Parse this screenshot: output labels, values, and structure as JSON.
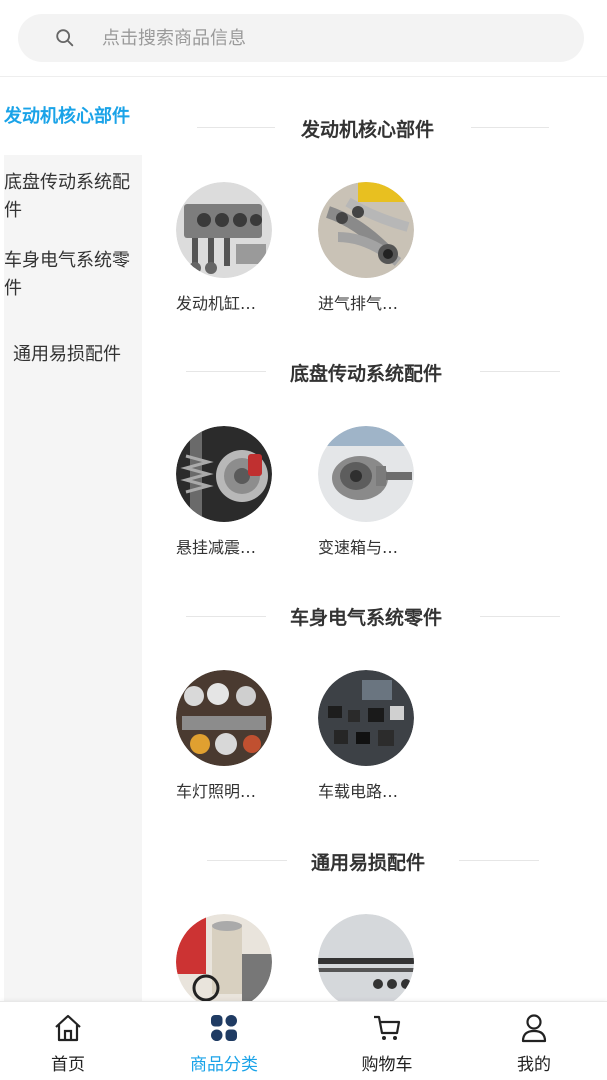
{
  "search": {
    "placeholder": "点击搜索商品信息"
  },
  "sidebar": {
    "items": [
      {
        "label": "发动机核心部件",
        "active": true
      },
      {
        "label": "底盘传动系统配件",
        "active": false
      },
      {
        "label": "车身电气系统零件",
        "active": false
      },
      {
        "label": "通用易损配件",
        "active": false
      }
    ]
  },
  "sections": [
    {
      "title": "发动机核心部件",
      "products": [
        {
          "name": "发动机缸…",
          "icon": "engine-block-photo"
        },
        {
          "name": "进气排气…",
          "icon": "exhaust-manifold-photo"
        }
      ]
    },
    {
      "title": "底盘传动系统配件",
      "products": [
        {
          "name": "悬挂减震…",
          "icon": "suspension-brake-photo"
        },
        {
          "name": "变速箱与…",
          "icon": "gearbox-photo"
        }
      ]
    },
    {
      "title": "车身电气系统零件",
      "products": [
        {
          "name": "车灯照明…",
          "icon": "headlights-photo"
        },
        {
          "name": "车载电路…",
          "icon": "electrical-parts-photo"
        }
      ]
    },
    {
      "title": "通用易损配件",
      "products": [
        {
          "name": "",
          "icon": "filters-photo"
        },
        {
          "name": "",
          "icon": "wiper-parts-photo"
        }
      ]
    }
  ],
  "bottom_nav": [
    {
      "label": "首页",
      "icon": "home-icon",
      "active": false
    },
    {
      "label": "商品分类",
      "icon": "category-grid-icon",
      "active": true
    },
    {
      "label": "购物车",
      "icon": "cart-icon",
      "active": false
    },
    {
      "label": "我的",
      "icon": "user-icon",
      "active": false
    }
  ],
  "colors": {
    "accent": "#1aa3e8",
    "nav_active_icon": "#1f3b63",
    "sidebar_bg": "#f5f5f5",
    "search_bg": "#f3f3f3"
  }
}
